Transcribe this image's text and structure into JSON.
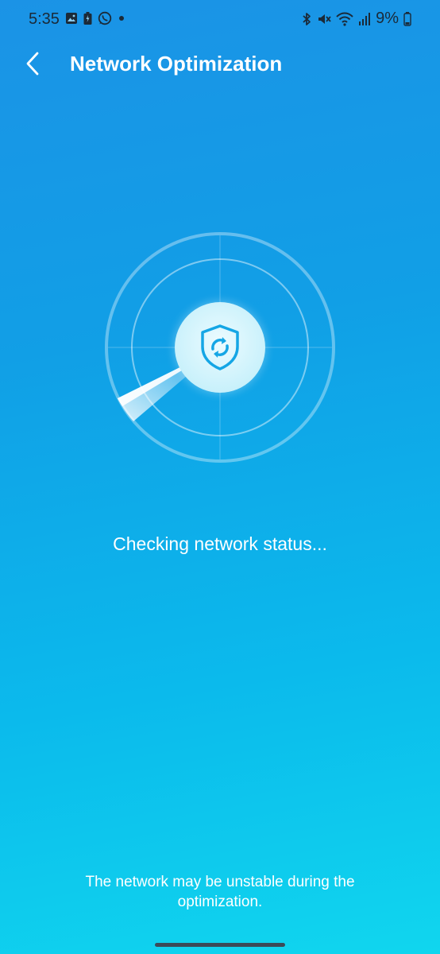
{
  "status_bar": {
    "time": "5:35",
    "left_icons": [
      "gallery-icon",
      "battery-saver-icon",
      "whatsapp-icon",
      "dot-icon"
    ],
    "right_icons": [
      "bluetooth-icon",
      "mute-icon",
      "wifi-icon",
      "signal-icon"
    ],
    "battery": "9%"
  },
  "header": {
    "back_icon": "chevron-left-icon",
    "title": "Network Optimization"
  },
  "scan": {
    "icon": "shield-refresh-icon",
    "status": "Checking network status..."
  },
  "footer": {
    "note": "The network may be unstable during the optimization."
  },
  "colors": {
    "background_top": "#1b93e6",
    "background_bottom": "#10d6ee",
    "accent": "#15a6e5",
    "text": "#ffffff"
  }
}
